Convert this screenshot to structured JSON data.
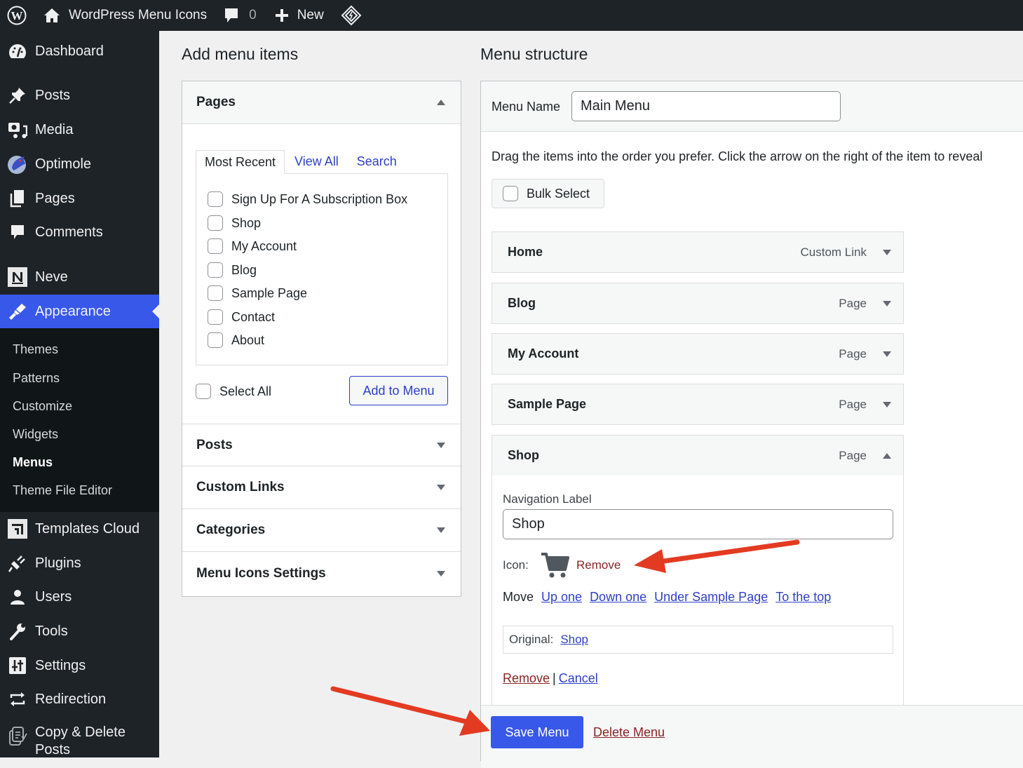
{
  "adminbar": {
    "site_name": "WordPress Menu Icons",
    "comments_count": "0",
    "new_label": "New"
  },
  "sidebar": {
    "items": [
      {
        "label": "Dashboard",
        "icon": "dashboard-icon"
      },
      {
        "label": "Posts",
        "icon": "pin-icon"
      },
      {
        "label": "Media",
        "icon": "media-icon"
      },
      {
        "label": "Optimole",
        "icon": "optimole-icon"
      },
      {
        "label": "Pages",
        "icon": "pages-icon"
      },
      {
        "label": "Comments",
        "icon": "comment-icon"
      },
      {
        "label": "Neve",
        "icon": "neve-icon"
      },
      {
        "label": "Appearance",
        "icon": "paintbrush-icon"
      },
      {
        "label": "Templates Cloud",
        "icon": "templates-cloud-icon"
      },
      {
        "label": "Plugins",
        "icon": "plug-icon"
      },
      {
        "label": "Users",
        "icon": "user-icon"
      },
      {
        "label": "Tools",
        "icon": "wrench-icon"
      },
      {
        "label": "Settings",
        "icon": "settings-icon"
      },
      {
        "label": "Redirection",
        "icon": "redirect-icon"
      },
      {
        "label": "Copy & Delete Posts",
        "icon": "copy-delete-icon"
      }
    ],
    "submenu": [
      "Themes",
      "Patterns",
      "Customize",
      "Widgets",
      "Menus",
      "Theme File Editor"
    ],
    "active_item": "Appearance",
    "active_sub": "Menus",
    "accent": "#3858e9"
  },
  "add_items": {
    "heading": "Add menu items",
    "pages_title": "Pages",
    "tabs": [
      "Most Recent",
      "View All",
      "Search"
    ],
    "pages": [
      "Sign Up For A Subscription Box",
      "Shop",
      "My Account",
      "Blog",
      "Sample Page",
      "Contact",
      "About"
    ],
    "select_all": "Select All",
    "add_button": "Add to Menu",
    "sections": [
      "Posts",
      "Custom Links",
      "Categories",
      "Menu Icons Settings"
    ]
  },
  "structure": {
    "heading": "Menu structure",
    "menu_name_label": "Menu Name",
    "menu_name_value": "Main Menu",
    "instructions": "Drag the items into the order you prefer. Click the arrow on the right of the item to reveal",
    "bulk_select": "Bulk Select",
    "items": [
      {
        "title": "Home",
        "type": "Custom Link"
      },
      {
        "title": "Blog",
        "type": "Page"
      },
      {
        "title": "My Account",
        "type": "Page"
      },
      {
        "title": "Sample Page",
        "type": "Page"
      },
      {
        "title": "Shop",
        "type": "Page"
      }
    ],
    "expanded": {
      "nav_label_label": "Navigation Label",
      "nav_label_value": "Shop",
      "icon_label": "Icon:",
      "icon": "cart-icon",
      "icon_remove": "Remove",
      "move_label": "Move",
      "move_links": [
        "Up one",
        "Down one",
        "Under Sample Page",
        "To the top"
      ],
      "original_label": "Original:",
      "original_link": "Shop",
      "remove": "Remove",
      "separator": "|",
      "cancel": "Cancel"
    },
    "save_button": "Save Menu",
    "delete_menu": "Delete Menu"
  },
  "annotations": {
    "arrow_color": "#e33b22"
  }
}
